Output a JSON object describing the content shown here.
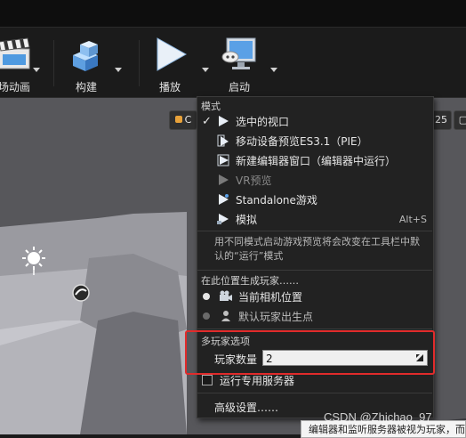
{
  "toolbar": {
    "buttons": [
      {
        "label": "场动画",
        "icon": "cinematics-clapper-icon"
      },
      {
        "label": "构建",
        "icon": "build-blocks-icon"
      },
      {
        "label": "播放",
        "icon": "play-icon"
      },
      {
        "label": "启动",
        "icon": "launch-monitor-icon"
      }
    ]
  },
  "viewport": {
    "chip_right_1": "25",
    "chip_left": "C"
  },
  "menu": {
    "modes_header": "模式",
    "modes": [
      {
        "label": "选中的视口",
        "checked": true,
        "disabled": false,
        "shortcut": ""
      },
      {
        "label": "移动设备预览ES3.1（PIE）",
        "checked": false,
        "disabled": false,
        "shortcut": ""
      },
      {
        "label": "新建编辑器窗口（编辑器中运行）",
        "checked": false,
        "disabled": false,
        "shortcut": ""
      },
      {
        "label": "VR预览",
        "checked": false,
        "disabled": true,
        "shortcut": ""
      },
      {
        "label": "Standalone游戏",
        "checked": false,
        "disabled": false,
        "shortcut": ""
      },
      {
        "label": "模拟",
        "checked": false,
        "disabled": false,
        "shortcut": "Alt+S"
      }
    ],
    "modes_desc": "用不同模式启动游戏预览将会改变在工具栏中默认的“运行”模式",
    "spawn_header": "在此位置生成玩家……",
    "spawn_options": [
      {
        "label": "当前相机位置",
        "selected": true
      },
      {
        "label": "默认玩家出生点",
        "selected": false
      }
    ],
    "multiplayer_header": "多玩家选项",
    "player_count_label": "玩家数量",
    "player_count_value": "2",
    "dedicated_server_label": "运行专用服务器",
    "advanced_label": "高级设置……"
  },
  "tooltip": {
    "text": "编辑器和监听服务器被视为玩家，而"
  },
  "watermark": "CSDN @Zhichao_97",
  "colors": {
    "highlight_box": "#e12b2b",
    "menu_bg": "#222222",
    "viewport_bg": "#5a5a5e"
  }
}
